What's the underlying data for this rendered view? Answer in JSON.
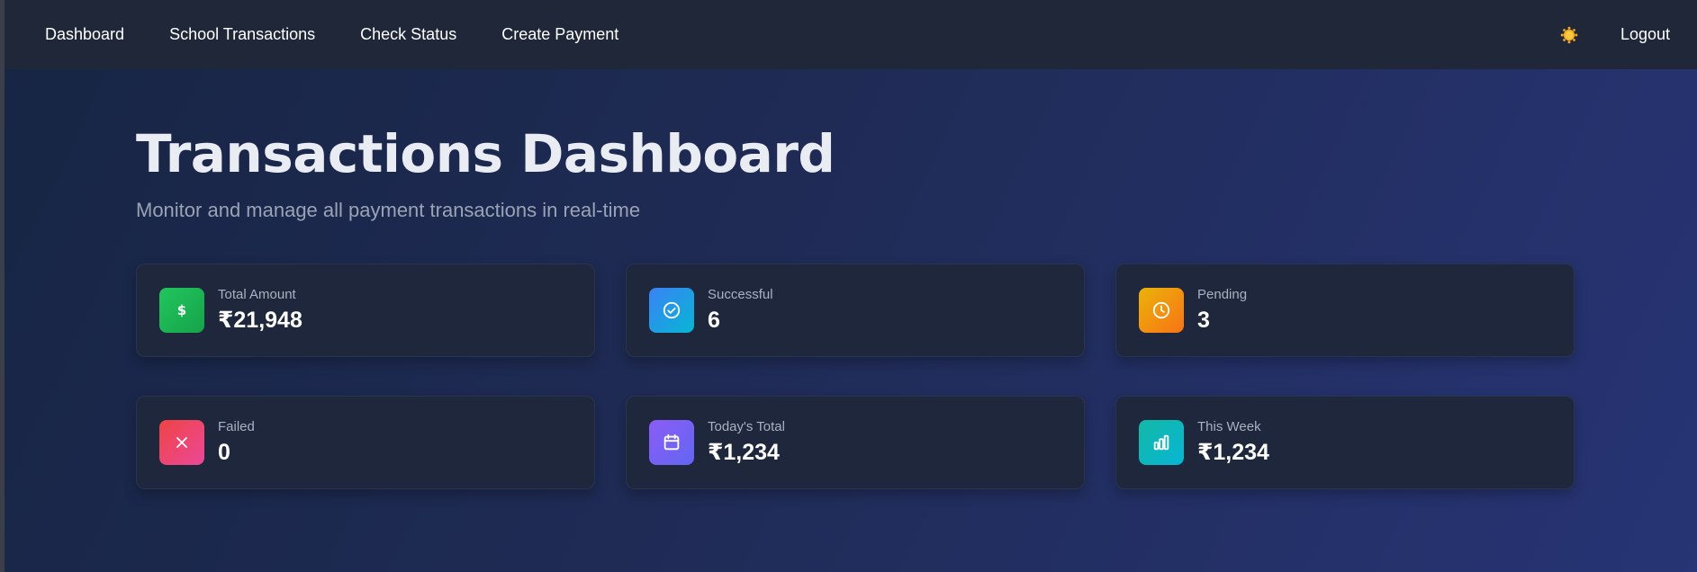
{
  "nav": {
    "links": [
      "Dashboard",
      "School Transactions",
      "Check Status",
      "Create Payment"
    ],
    "logout_label": "Logout",
    "theme_icon": "sun-icon"
  },
  "header": {
    "title": "Transactions Dashboard",
    "subtitle": "Monitor and manage all payment transactions in real-time"
  },
  "stats": [
    {
      "label": "Total Amount",
      "value": "₹21,948",
      "icon": "dollar-icon",
      "color_from": "#22c55e",
      "color_to": "#16a34a"
    },
    {
      "label": "Successful",
      "value": "6",
      "icon": "check-circle-icon",
      "color_from": "#3b82f6",
      "color_to": "#06b6d4"
    },
    {
      "label": "Pending",
      "value": "3",
      "icon": "clock-icon",
      "color_from": "#eab308",
      "color_to": "#f97316"
    },
    {
      "label": "Failed",
      "value": "0",
      "icon": "x-icon",
      "color_from": "#ef4444",
      "color_to": "#ec4899"
    },
    {
      "label": "Today's Total",
      "value": "₹1,234",
      "icon": "calendar-icon",
      "color_from": "#8b5cf6",
      "color_to": "#6366f1"
    },
    {
      "label": "This Week",
      "value": "₹1,234",
      "icon": "bar-chart-icon",
      "color_from": "#14b8a6",
      "color_to": "#06b6d4"
    }
  ]
}
